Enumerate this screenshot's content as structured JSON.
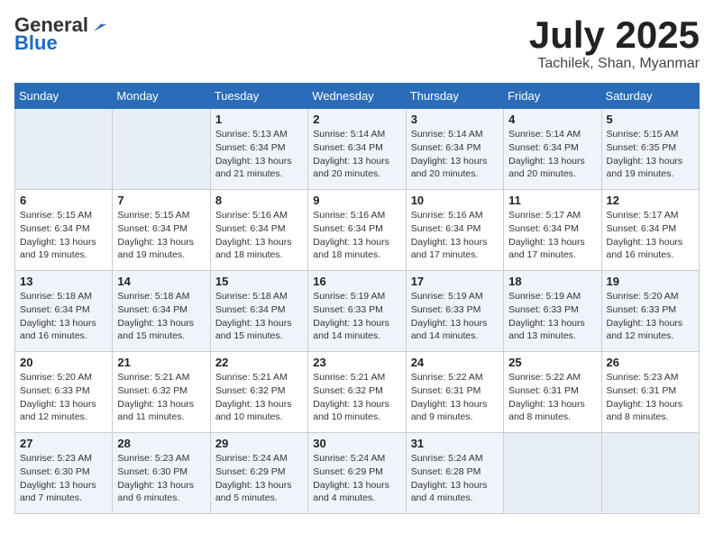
{
  "logo": {
    "general": "General",
    "blue": "Blue"
  },
  "title": "July 2025",
  "location": "Tachilek, Shan, Myanmar",
  "days_of_week": [
    "Sunday",
    "Monday",
    "Tuesday",
    "Wednesday",
    "Thursday",
    "Friday",
    "Saturday"
  ],
  "weeks": [
    [
      {
        "day": "",
        "info": ""
      },
      {
        "day": "",
        "info": ""
      },
      {
        "day": "1",
        "info": "Sunrise: 5:13 AM\nSunset: 6:34 PM\nDaylight: 13 hours and 21 minutes."
      },
      {
        "day": "2",
        "info": "Sunrise: 5:14 AM\nSunset: 6:34 PM\nDaylight: 13 hours and 20 minutes."
      },
      {
        "day": "3",
        "info": "Sunrise: 5:14 AM\nSunset: 6:34 PM\nDaylight: 13 hours and 20 minutes."
      },
      {
        "day": "4",
        "info": "Sunrise: 5:14 AM\nSunset: 6:34 PM\nDaylight: 13 hours and 20 minutes."
      },
      {
        "day": "5",
        "info": "Sunrise: 5:15 AM\nSunset: 6:35 PM\nDaylight: 13 hours and 19 minutes."
      }
    ],
    [
      {
        "day": "6",
        "info": "Sunrise: 5:15 AM\nSunset: 6:34 PM\nDaylight: 13 hours and 19 minutes."
      },
      {
        "day": "7",
        "info": "Sunrise: 5:15 AM\nSunset: 6:34 PM\nDaylight: 13 hours and 19 minutes."
      },
      {
        "day": "8",
        "info": "Sunrise: 5:16 AM\nSunset: 6:34 PM\nDaylight: 13 hours and 18 minutes."
      },
      {
        "day": "9",
        "info": "Sunrise: 5:16 AM\nSunset: 6:34 PM\nDaylight: 13 hours and 18 minutes."
      },
      {
        "day": "10",
        "info": "Sunrise: 5:16 AM\nSunset: 6:34 PM\nDaylight: 13 hours and 17 minutes."
      },
      {
        "day": "11",
        "info": "Sunrise: 5:17 AM\nSunset: 6:34 PM\nDaylight: 13 hours and 17 minutes."
      },
      {
        "day": "12",
        "info": "Sunrise: 5:17 AM\nSunset: 6:34 PM\nDaylight: 13 hours and 16 minutes."
      }
    ],
    [
      {
        "day": "13",
        "info": "Sunrise: 5:18 AM\nSunset: 6:34 PM\nDaylight: 13 hours and 16 minutes."
      },
      {
        "day": "14",
        "info": "Sunrise: 5:18 AM\nSunset: 6:34 PM\nDaylight: 13 hours and 15 minutes."
      },
      {
        "day": "15",
        "info": "Sunrise: 5:18 AM\nSunset: 6:34 PM\nDaylight: 13 hours and 15 minutes."
      },
      {
        "day": "16",
        "info": "Sunrise: 5:19 AM\nSunset: 6:33 PM\nDaylight: 13 hours and 14 minutes."
      },
      {
        "day": "17",
        "info": "Sunrise: 5:19 AM\nSunset: 6:33 PM\nDaylight: 13 hours and 14 minutes."
      },
      {
        "day": "18",
        "info": "Sunrise: 5:19 AM\nSunset: 6:33 PM\nDaylight: 13 hours and 13 minutes."
      },
      {
        "day": "19",
        "info": "Sunrise: 5:20 AM\nSunset: 6:33 PM\nDaylight: 13 hours and 12 minutes."
      }
    ],
    [
      {
        "day": "20",
        "info": "Sunrise: 5:20 AM\nSunset: 6:33 PM\nDaylight: 13 hours and 12 minutes."
      },
      {
        "day": "21",
        "info": "Sunrise: 5:21 AM\nSunset: 6:32 PM\nDaylight: 13 hours and 11 minutes."
      },
      {
        "day": "22",
        "info": "Sunrise: 5:21 AM\nSunset: 6:32 PM\nDaylight: 13 hours and 10 minutes."
      },
      {
        "day": "23",
        "info": "Sunrise: 5:21 AM\nSunset: 6:32 PM\nDaylight: 13 hours and 10 minutes."
      },
      {
        "day": "24",
        "info": "Sunrise: 5:22 AM\nSunset: 6:31 PM\nDaylight: 13 hours and 9 minutes."
      },
      {
        "day": "25",
        "info": "Sunrise: 5:22 AM\nSunset: 6:31 PM\nDaylight: 13 hours and 8 minutes."
      },
      {
        "day": "26",
        "info": "Sunrise: 5:23 AM\nSunset: 6:31 PM\nDaylight: 13 hours and 8 minutes."
      }
    ],
    [
      {
        "day": "27",
        "info": "Sunrise: 5:23 AM\nSunset: 6:30 PM\nDaylight: 13 hours and 7 minutes."
      },
      {
        "day": "28",
        "info": "Sunrise: 5:23 AM\nSunset: 6:30 PM\nDaylight: 13 hours and 6 minutes."
      },
      {
        "day": "29",
        "info": "Sunrise: 5:24 AM\nSunset: 6:29 PM\nDaylight: 13 hours and 5 minutes."
      },
      {
        "day": "30",
        "info": "Sunrise: 5:24 AM\nSunset: 6:29 PM\nDaylight: 13 hours and 4 minutes."
      },
      {
        "day": "31",
        "info": "Sunrise: 5:24 AM\nSunset: 6:28 PM\nDaylight: 13 hours and 4 minutes."
      },
      {
        "day": "",
        "info": ""
      },
      {
        "day": "",
        "info": ""
      }
    ]
  ]
}
